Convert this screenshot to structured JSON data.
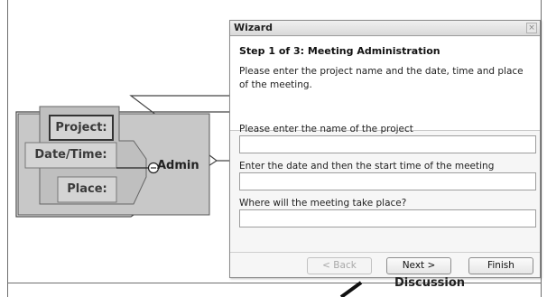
{
  "wizard": {
    "title": "Wizard",
    "close_glyph": "×",
    "step_title": "Step 1 of 3: Meeting Administration",
    "step_description": "Please enter the project name and the date, time and place of the meeting.",
    "fields": [
      {
        "label": "Please enter the name of the project",
        "value": ""
      },
      {
        "label": "Enter the date and then the start time of the meeting",
        "value": ""
      },
      {
        "label": "Where will the meeting take place?",
        "value": ""
      }
    ],
    "buttons": {
      "back": "< Back",
      "next": "Next >",
      "finish": "Finish"
    }
  },
  "diagram": {
    "boxes": {
      "project": "Project:",
      "datetime": "Date/Time:",
      "place": "Place:"
    },
    "admin_label": "Admin",
    "discussion_label": "Discussion"
  },
  "colors": {
    "diagram_fill": "#c8c8c8",
    "box_fill": "#d4d4d4",
    "dialog_bg": "#f6f6f6"
  }
}
